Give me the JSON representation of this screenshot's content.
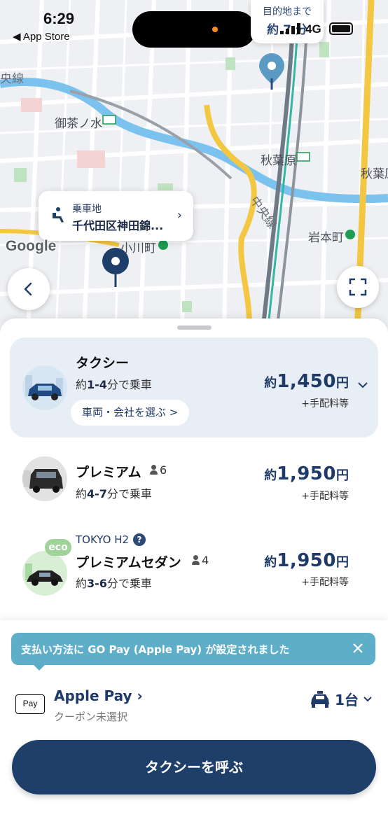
{
  "status_bar": {
    "time": "6:29",
    "back_app": "◀ App Store",
    "network": "4G"
  },
  "map": {
    "labels": {
      "jr_ochanomizu": "御茶ノ水",
      "akihabara": "秋葉原",
      "akihabara_right": "秋葉原",
      "iwamotocho": "岩本町",
      "ogawamachi": "小川町",
      "chuo_line": "中央線",
      "line_top_left": "央線"
    },
    "destination_bubble": {
      "title": "目的地まで",
      "eta": "約 7 分"
    },
    "pickup_bubble": {
      "title": "乗車地",
      "address": "千代田区神田錦..."
    },
    "attribution": "Google"
  },
  "ride_options": [
    {
      "name": "タクシー",
      "eta_prefix": "約",
      "eta_range": "1-4",
      "eta_suffix": "分で乗車",
      "price_prefix": "約",
      "price": "1,450",
      "price_unit": "円",
      "fee": "+手配料等",
      "vehicle_button": "車両・会社を選ぶ >"
    },
    {
      "name": "プレミアム",
      "capacity": "6",
      "eta_prefix": "約",
      "eta_range": "4-7",
      "eta_suffix": "分で乗車",
      "price_prefix": "約",
      "price": "1,950",
      "price_unit": "円",
      "fee": "+手配料等"
    },
    {
      "brand": "TOKYO H2",
      "badge": "eco",
      "name": "プレミアムセダン",
      "capacity": "4",
      "eta_prefix": "約",
      "eta_range": "3-6",
      "eta_suffix": "分で乗車",
      "price_prefix": "約",
      "price": "1,950",
      "price_unit": "円",
      "fee": "+手配料等"
    }
  ],
  "payment": {
    "banner": "支払い方法に GO Pay (Apple Pay) が設定されました",
    "badge": "Pay",
    "method": "Apple Pay",
    "coupon": "クーポン未選択",
    "car_count": "1台"
  },
  "cta": {
    "label": "タクシーを呼ぶ"
  },
  "colors": {
    "brand_navy": "#1f3f6b",
    "banner_blue": "#5eaec9",
    "selected_bg": "#e8eef6"
  }
}
